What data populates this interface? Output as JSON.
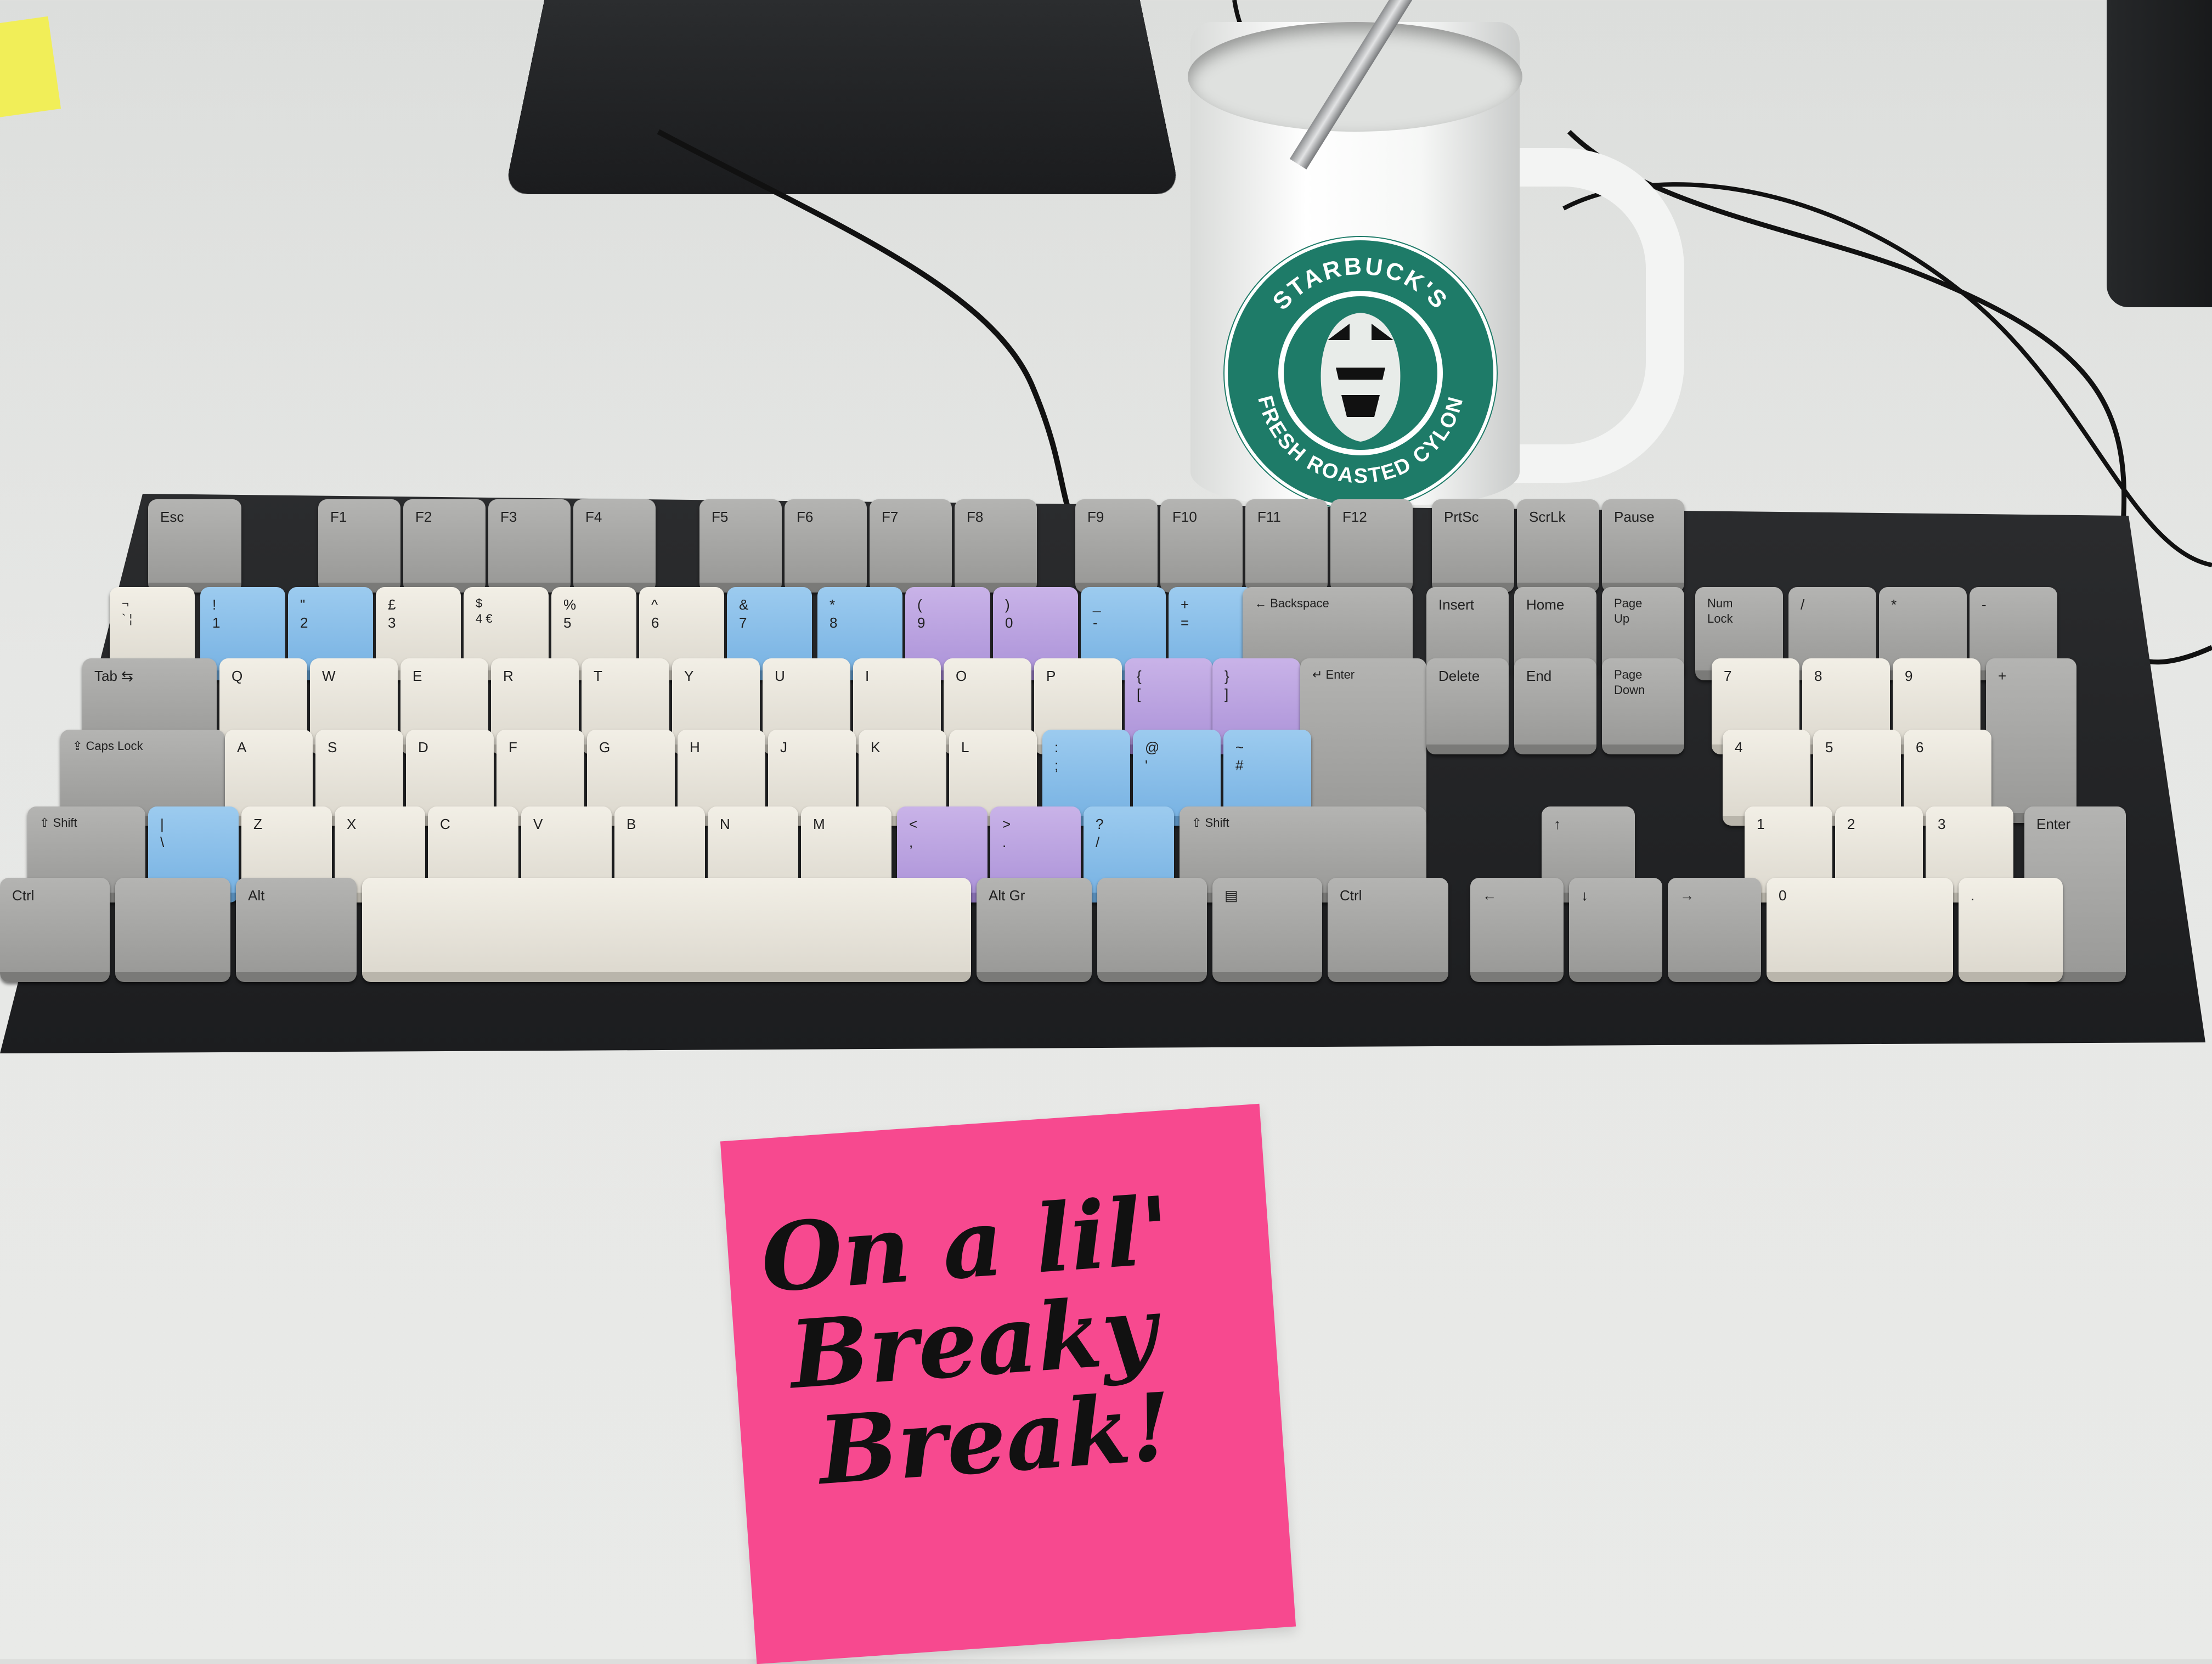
{
  "scene": {
    "desk_color": "#e7e8e6",
    "keyboard_case_color": "#1f2022",
    "key_colors": {
      "alpha": "#e9e6dd",
      "modifier": "#a8a8a6",
      "blue": "#8cc0ea",
      "purple": "#bca4e1"
    }
  },
  "mug": {
    "logo_text_top": "STARBUCK'S",
    "logo_text_bottom": "FRESH ROASTED CYLON",
    "logo_color": "#1e7b68"
  },
  "sticky_note": {
    "color": "#f7498f",
    "lines": [
      "On a lil'",
      "Breaky",
      "Break!"
    ]
  },
  "keyboard": {
    "rows": [
      [
        {
          "label": "Esc",
          "color": "gray"
        },
        {
          "label": "F1",
          "color": "gray"
        },
        {
          "label": "F2",
          "color": "gray"
        },
        {
          "label": "F3",
          "color": "gray"
        },
        {
          "label": "F4",
          "color": "gray"
        },
        {
          "label": "F5",
          "color": "gray"
        },
        {
          "label": "F6",
          "color": "gray"
        },
        {
          "label": "F7",
          "color": "gray"
        },
        {
          "label": "F8",
          "color": "gray"
        },
        {
          "label": "F9",
          "color": "gray"
        },
        {
          "label": "F10",
          "color": "gray"
        },
        {
          "label": "F11",
          "color": "gray"
        },
        {
          "label": "F12",
          "color": "gray"
        },
        {
          "label": "PrtSc",
          "color": "gray"
        },
        {
          "label": "ScrLk",
          "color": "gray"
        },
        {
          "label": "Pause",
          "color": "gray"
        }
      ],
      [
        {
          "label": "¬\n`   ¦",
          "color": "alpha"
        },
        {
          "label": "!\n1",
          "color": "blue"
        },
        {
          "label": "\"\n2",
          "color": "blue"
        },
        {
          "label": "£\n3",
          "color": "alpha"
        },
        {
          "label": "$\n4   €",
          "color": "alpha"
        },
        {
          "label": "%\n5",
          "color": "alpha"
        },
        {
          "label": "^\n6",
          "color": "alpha"
        },
        {
          "label": "&\n7",
          "color": "blue"
        },
        {
          "label": "*\n8",
          "color": "blue"
        },
        {
          "label": "(\n9",
          "color": "purple"
        },
        {
          "label": ")\n0",
          "color": "purple"
        },
        {
          "label": "_\n-",
          "color": "blue"
        },
        {
          "label": "+\n=",
          "color": "blue"
        },
        {
          "label": "← Backspace",
          "color": "gray"
        },
        {
          "label": "Insert",
          "color": "gray"
        },
        {
          "label": "Home",
          "color": "gray"
        },
        {
          "label": "Page\nUp",
          "color": "gray"
        },
        {
          "label": "Num\nLock",
          "color": "gray"
        },
        {
          "label": "/",
          "color": "gray"
        },
        {
          "label": "*",
          "color": "gray"
        },
        {
          "label": "-",
          "color": "gray"
        }
      ],
      [
        {
          "label": "Tab ⇆",
          "color": "gray"
        },
        {
          "label": "Q",
          "color": "alpha"
        },
        {
          "label": "W",
          "color": "alpha"
        },
        {
          "label": "E",
          "color": "alpha"
        },
        {
          "label": "R",
          "color": "alpha"
        },
        {
          "label": "T",
          "color": "alpha"
        },
        {
          "label": "Y",
          "color": "alpha"
        },
        {
          "label": "U",
          "color": "alpha"
        },
        {
          "label": "I",
          "color": "alpha"
        },
        {
          "label": "O",
          "color": "alpha"
        },
        {
          "label": "P",
          "color": "alpha"
        },
        {
          "label": "{\n[",
          "color": "purple"
        },
        {
          "label": "}\n]",
          "color": "purple"
        },
        {
          "label": "↵ Enter",
          "color": "gray"
        },
        {
          "label": "Delete",
          "color": "gray"
        },
        {
          "label": "End",
          "color": "gray"
        },
        {
          "label": "Page\nDown",
          "color": "gray"
        },
        {
          "label": "7",
          "color": "alpha"
        },
        {
          "label": "8",
          "color": "alpha"
        },
        {
          "label": "9",
          "color": "alpha"
        },
        {
          "label": "+",
          "color": "gray"
        }
      ],
      [
        {
          "label": "⇪ Caps Lock",
          "color": "gray"
        },
        {
          "label": "A",
          "color": "alpha"
        },
        {
          "label": "S",
          "color": "alpha"
        },
        {
          "label": "D",
          "color": "alpha"
        },
        {
          "label": "F",
          "color": "alpha"
        },
        {
          "label": "G",
          "color": "alpha"
        },
        {
          "label": "H",
          "color": "alpha"
        },
        {
          "label": "J",
          "color": "alpha"
        },
        {
          "label": "K",
          "color": "alpha"
        },
        {
          "label": "L",
          "color": "alpha"
        },
        {
          "label": ":\n;",
          "color": "blue"
        },
        {
          "label": "@\n'",
          "color": "blue"
        },
        {
          "label": "~\n#",
          "color": "blue"
        },
        {
          "label": "4",
          "color": "alpha"
        },
        {
          "label": "5",
          "color": "alpha"
        },
        {
          "label": "6",
          "color": "alpha"
        }
      ],
      [
        {
          "label": "⇧ Shift",
          "color": "gray"
        },
        {
          "label": "|\n\\",
          "color": "blue"
        },
        {
          "label": "Z",
          "color": "alpha"
        },
        {
          "label": "X",
          "color": "alpha"
        },
        {
          "label": "C",
          "color": "alpha"
        },
        {
          "label": "V",
          "color": "alpha"
        },
        {
          "label": "B",
          "color": "alpha"
        },
        {
          "label": "N",
          "color": "alpha"
        },
        {
          "label": "M",
          "color": "alpha"
        },
        {
          "label": "<\n,",
          "color": "purple"
        },
        {
          "label": ">\n.",
          "color": "purple"
        },
        {
          "label": "?\n/",
          "color": "blue"
        },
        {
          "label": "⇧ Shift",
          "color": "gray"
        },
        {
          "label": "↑",
          "color": "gray"
        },
        {
          "label": "1",
          "color": "alpha"
        },
        {
          "label": "2",
          "color": "alpha"
        },
        {
          "label": "3",
          "color": "alpha"
        },
        {
          "label": "Enter",
          "color": "gray"
        }
      ],
      [
        {
          "label": "Ctrl",
          "color": "gray"
        },
        {
          "label": "",
          "color": "gray"
        },
        {
          "label": "Alt",
          "color": "gray"
        },
        {
          "label": "",
          "color": "alpha"
        },
        {
          "label": "Alt Gr",
          "color": "gray"
        },
        {
          "label": "",
          "color": "gray"
        },
        {
          "label": "▤",
          "color": "gray"
        },
        {
          "label": "Ctrl",
          "color": "gray"
        },
        {
          "label": "←",
          "color": "gray"
        },
        {
          "label": "↓",
          "color": "gray"
        },
        {
          "label": "→",
          "color": "gray"
        },
        {
          "label": "0",
          "color": "alpha"
        },
        {
          "label": ".",
          "color": "alpha"
        }
      ]
    ]
  }
}
